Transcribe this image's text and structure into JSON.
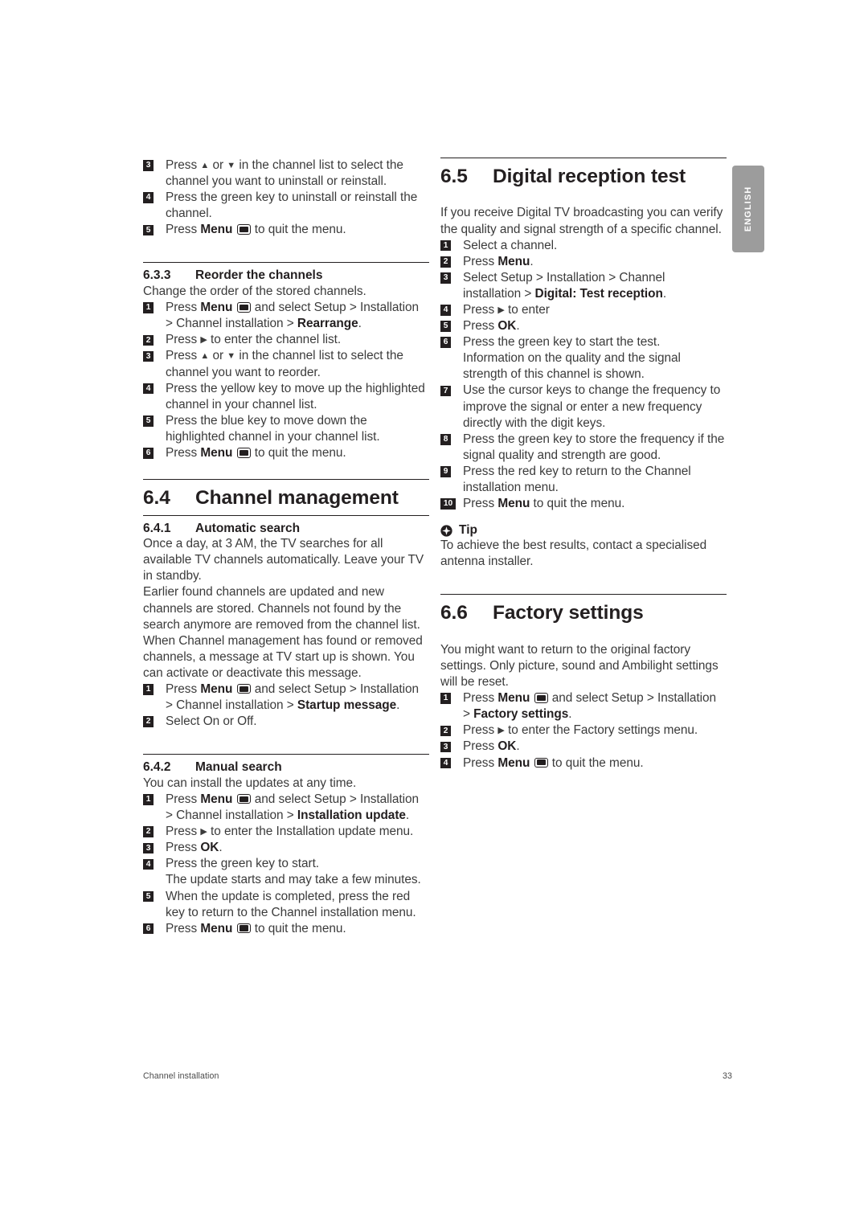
{
  "language_tab": "ENGLISH",
  "footer": {
    "left": "Channel installation",
    "page_number": "33"
  },
  "left_column": {
    "uninstall_steps": [
      {
        "n": "3",
        "text": "Press ▲ or ▼ in the channel list to select the channel you want to uninstall or reinstall."
      },
      {
        "n": "4",
        "text": "Press the green key to uninstall or reinstall the channel."
      },
      {
        "n": "5",
        "text": "Press Menu ▣ to quit the menu."
      }
    ],
    "reorder": {
      "number": "6.3.3",
      "title": "Reorder the channels",
      "intro": "Change the order of the stored channels.",
      "steps": [
        {
          "n": "1",
          "text": "Press Menu ▣ and select Setup > Installation > Channel installation > Rearrange."
        },
        {
          "n": "2",
          "text": "Press ▶ to enter the channel list."
        },
        {
          "n": "3",
          "text": "Press ▲ or ▼ in the channel list to select the channel you want to reorder."
        },
        {
          "n": "4",
          "text": "Press the yellow key to move up the highlighted channel in your channel list."
        },
        {
          "n": "5",
          "text": "Press the blue key to move down the highlighted channel in your channel list."
        },
        {
          "n": "6",
          "text": "Press Menu ▣ to quit the menu."
        }
      ]
    },
    "channel_management": {
      "number": "6.4",
      "title": "Channel management",
      "automatic_search": {
        "number": "6.4.1",
        "title": "Automatic search",
        "para1": "Once a day, at 3 AM, the TV searches for all available TV channels automatically. Leave your TV in standby.",
        "para2": "Earlier found channels are updated and new channels are stored. Channels not found by the search anymore are removed from the channel list. When Channel management has found or removed channels, a message at TV start up is shown. You can activate or deactivate this message.",
        "steps": [
          {
            "n": "1",
            "text": "Press Menu ▣ and select Setup > Installation > Channel installation > Startup message."
          },
          {
            "n": "2",
            "text": "Select On or Off."
          }
        ]
      },
      "manual_search": {
        "number": "6.4.2",
        "title": "Manual search",
        "intro": "You can install the updates at any time.",
        "steps": [
          {
            "n": "1",
            "text": "Press Menu ▣ and select Setup > Installation > Channel installation > Installation update."
          },
          {
            "n": "2",
            "text": "Press ▶ to enter the Installation update menu."
          },
          {
            "n": "3",
            "text": "Press OK."
          },
          {
            "n": "4",
            "text": "Press the green key to start. The update starts and may take a few minutes."
          },
          {
            "n": "5",
            "text": "When the update is completed, press the red key to return to the Channel installation menu."
          },
          {
            "n": "6",
            "text": "Press Menu ▣ to quit the menu."
          }
        ]
      }
    }
  },
  "right_column": {
    "digital_reception_test": {
      "number": "6.5",
      "title": "Digital reception test",
      "intro": "If you receive Digital TV broadcasting you can verify the quality and signal strength of a specific channel.",
      "steps": [
        {
          "n": "1",
          "text": "Select a channel."
        },
        {
          "n": "2",
          "text": "Press Menu."
        },
        {
          "n": "3",
          "text": "Select Setup > Installation > Channel installation > Digital: Test reception."
        },
        {
          "n": "4",
          "text": "Press ▶ to enter"
        },
        {
          "n": "5",
          "text": "Press OK."
        },
        {
          "n": "6",
          "text": "Press the green key to start the test. Information on the quality and the signal strength of this channel is shown."
        },
        {
          "n": "7",
          "text": "Use the cursor keys to change the frequency to improve the signal or enter a new frequency directly with the digit keys."
        },
        {
          "n": "8",
          "text": "Press the green key to store the frequency if the signal quality and strength are good."
        },
        {
          "n": "9",
          "text": "Press the red key to return to the Channel installation menu."
        },
        {
          "n": "10",
          "text": "Press Menu to quit the menu."
        }
      ],
      "tip": {
        "label": "Tip",
        "text": "To achieve the best results, contact a specialised antenna installer."
      }
    },
    "factory_settings": {
      "number": "6.6",
      "title": "Factory settings",
      "intro": "You might want to return to the original factory settings. Only picture, sound and Ambilight settings will be reset.",
      "steps": [
        {
          "n": "1",
          "text": "Press Menu ▣ and select Setup > Installation > Factory settings."
        },
        {
          "n": "2",
          "text": "Press ▶ to enter the Factory settings menu."
        },
        {
          "n": "3",
          "text": "Press OK."
        },
        {
          "n": "4",
          "text": "Press Menu ▣ to quit the menu."
        }
      ]
    }
  }
}
